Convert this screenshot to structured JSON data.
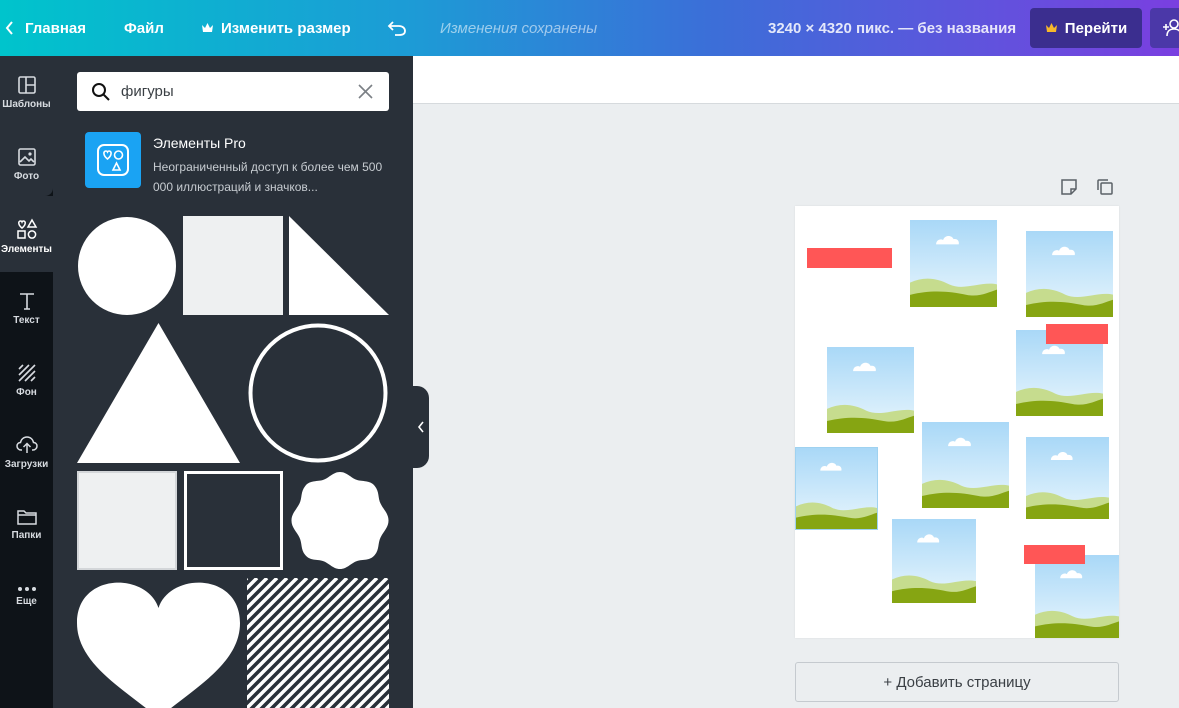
{
  "topbar": {
    "home_label": "Главная",
    "file_label": "Файл",
    "resize_label": "Изменить размер",
    "saved_status": "Изменения сохранены",
    "design_info": "3240 × 4320 пикс. — без названия",
    "go_label": "Перейти"
  },
  "rail": {
    "items": [
      {
        "label": "Шаблоны",
        "icon": "templates-icon"
      },
      {
        "label": "Фото",
        "icon": "photo-icon"
      },
      {
        "label": "Элементы",
        "icon": "elements-icon"
      },
      {
        "label": "Текст",
        "icon": "text-icon"
      },
      {
        "label": "Фон",
        "icon": "background-icon"
      },
      {
        "label": "Загрузки",
        "icon": "upload-icon"
      },
      {
        "label": "Папки",
        "icon": "folder-icon"
      },
      {
        "label": "Еще",
        "icon": "more-icon"
      }
    ]
  },
  "panel": {
    "search_value": "фигуры",
    "pro_title": "Элементы Pro",
    "pro_description": "Неограниченный доступ к более чем 500 000 иллюстраций и значков..."
  },
  "editor": {
    "add_page_label": "+ Добавить страницу"
  },
  "colors": {
    "accent_red": "#ff5656",
    "pro_blue": "#1aa3f3",
    "panel_bg": "#293039",
    "rail_bg": "#0e1318"
  }
}
